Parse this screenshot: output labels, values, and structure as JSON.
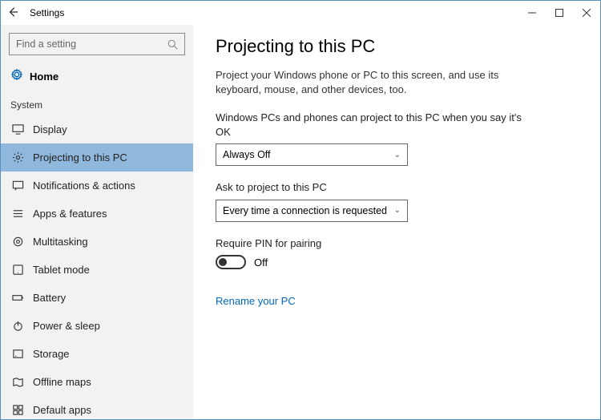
{
  "titlebar": {
    "title": "Settings"
  },
  "search": {
    "placeholder": "Find a setting"
  },
  "home": {
    "label": "Home"
  },
  "section": "System",
  "nav": [
    {
      "label": "Display",
      "icon": "display",
      "selected": false
    },
    {
      "label": "Projecting to this PC",
      "icon": "gear",
      "selected": true
    },
    {
      "label": "Notifications & actions",
      "icon": "message",
      "selected": false
    },
    {
      "label": "Apps & features",
      "icon": "list",
      "selected": false
    },
    {
      "label": "Multitasking",
      "icon": "gear-outline",
      "selected": false
    },
    {
      "label": "Tablet mode",
      "icon": "tablet",
      "selected": false
    },
    {
      "label": "Battery",
      "icon": "battery",
      "selected": false
    },
    {
      "label": "Power & sleep",
      "icon": "power",
      "selected": false
    },
    {
      "label": "Storage",
      "icon": "storage",
      "selected": false
    },
    {
      "label": "Offline maps",
      "icon": "map",
      "selected": false
    },
    {
      "label": "Default apps",
      "icon": "defaults",
      "selected": false
    }
  ],
  "main": {
    "heading": "Projecting to this PC",
    "description": "Project your Windows phone or PC to this screen, and use its keyboard, mouse, and other devices, too.",
    "setting1": {
      "label": "Windows PCs and phones can project to this PC when you say it's OK",
      "value": "Always Off"
    },
    "setting2": {
      "label": "Ask to project to this PC",
      "value": "Every time a connection is requested"
    },
    "setting3": {
      "label": "Require PIN for pairing",
      "state": "Off"
    },
    "link": "Rename your PC"
  }
}
